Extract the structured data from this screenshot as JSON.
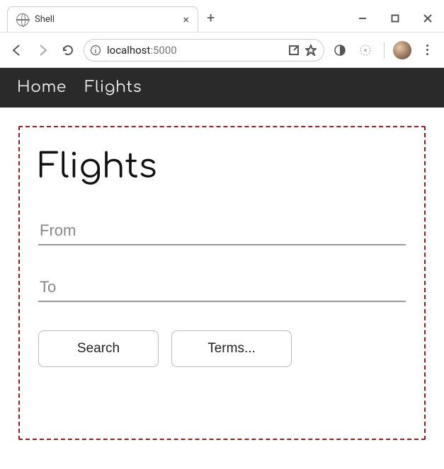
{
  "browser": {
    "tab_title": "Shell",
    "url_host": "localhost",
    "url_port": ":5000"
  },
  "nav": {
    "home": "Home",
    "flights": "Flights"
  },
  "page": {
    "title": "Flights",
    "from_placeholder": "From",
    "to_placeholder": "To",
    "search_label": "Search",
    "terms_label": "Terms..."
  }
}
